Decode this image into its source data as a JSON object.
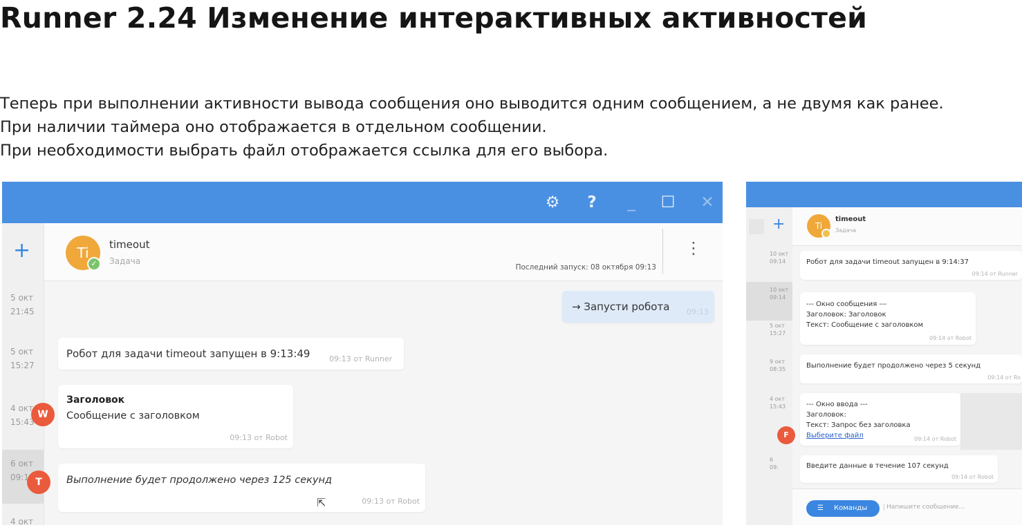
{
  "slide": {
    "title": "Runner 2.24 Изменение интерактивных активностей",
    "lines": [
      "Теперь при выполнении активности вывода сообщения оно выводится одним сообщением, а не двумя как ранее.",
      "При наличии таймера оно отображается в отдельном сообщении.",
      "При необходимости выбрать файл отображается ссылка для его выбора."
    ]
  },
  "colors": {
    "topbar": "#4a90e2",
    "avatar": "#f0a83a",
    "badge": "#ea5a3c",
    "accent": "#3a86e0"
  },
  "left_window": {
    "toolbar_icons": [
      "gear-icon",
      "help-icon",
      "minimize-icon",
      "maximize-icon",
      "close-icon"
    ],
    "toolbar_glyphs": {
      "gear": "⚙",
      "help": "?",
      "minimize": "_",
      "maximize": "☐",
      "close": "✕"
    },
    "add_glyph": "+",
    "dates": [
      {
        "line1": "5 окт",
        "line2": "21:45"
      },
      {
        "line1": "5 окт",
        "line2": "15:27"
      },
      {
        "line1": "4 окт",
        "line2": "15:43"
      },
      {
        "line1": "6 окт",
        "line2": "09:1"
      },
      {
        "line1": "4 окт",
        "line2": ""
      }
    ],
    "task": {
      "avatar_initials": "Ti",
      "name": "timeout",
      "subtitle": "Задача",
      "last_run": "Последний запуск: 08 октября 09:13",
      "menu_glyph": "⋮"
    },
    "messages": {
      "outgoing": {
        "text": "→ Запусти робота",
        "time": "09:13"
      },
      "runner": {
        "text": "Робот для задачи timeout запущен в 9:13:49",
        "meta": "09:13 от Runner"
      },
      "titled": {
        "heading": "Заголовок",
        "text": "Сообщение с заголовком",
        "meta": "09:13 от Robot",
        "badge": "W"
      },
      "timer": {
        "text": "Выполнение будет продолжено через 125 секунд",
        "meta": "09:13 от Robot",
        "badge": "T"
      }
    },
    "cursor_glyph": "⇱"
  },
  "right_window": {
    "add_glyph": "+",
    "dates": [
      {
        "line1": "10 окт",
        "line2": "09:14"
      },
      {
        "line1": "10 окт",
        "line2": "09:14"
      },
      {
        "line1": "5 окт",
        "line2": "15:27"
      },
      {
        "line1": "9 окт",
        "line2": "08:35"
      },
      {
        "line1": "4 окт",
        "line2": "15:43"
      },
      {
        "line1": "6",
        "line2": "09:"
      }
    ],
    "task": {
      "avatar_initials": "Ti",
      "name": "timeout",
      "subtitle": "Задача"
    },
    "messages": {
      "runner": {
        "text": "Робот для задачи timeout запущен в 9:14:37",
        "meta": "09:14 от Runner"
      },
      "window": {
        "line1": "--- Окно сообщения ---",
        "line2": "Заголовок: Заголовок",
        "line3": "Текст: Сообщение с заголовком",
        "meta": "09:14 от Robot"
      },
      "continue": {
        "text": "Выполнение будет продолжено через 5 секунд",
        "meta": "09:14 от Ro"
      },
      "input": {
        "line1": "--- Окно ввода ---",
        "line2": "Заголовок:",
        "line3": "Текст: Запрос без заголовка",
        "link": "Выберите файл",
        "meta": "09:14 от Robot",
        "badge": "F"
      },
      "enter": {
        "text": "Введите данные в течение 107 секунд",
        "meta": "09:14 от Robot"
      }
    },
    "commands_button": "Команды",
    "commands_glyph": "☰",
    "message_placeholder": "Напишите сообщение..."
  }
}
